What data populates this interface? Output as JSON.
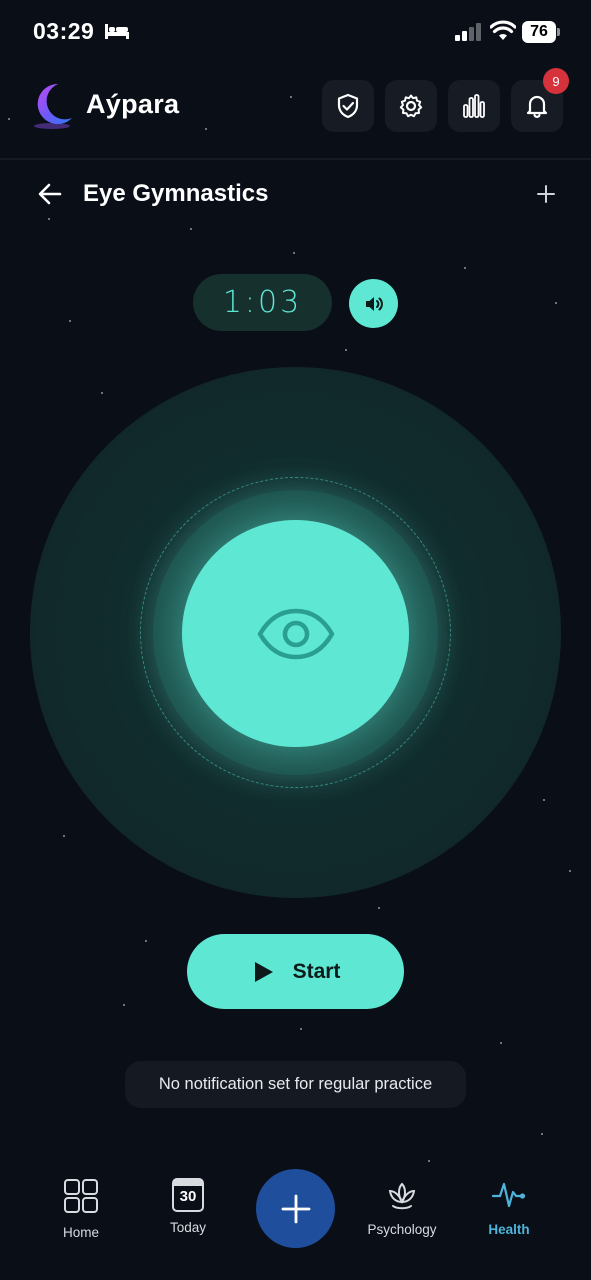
{
  "status_bar": {
    "time": "03:29",
    "battery": "76"
  },
  "app": {
    "title": "Aýpara",
    "notification_count": "9"
  },
  "page": {
    "title": "Eye Gymnastics"
  },
  "timer": {
    "display": "1:03"
  },
  "start_button": {
    "label": "Start"
  },
  "notification_note": {
    "text": "No notification set for regular practice"
  },
  "bottom_nav": {
    "items": [
      {
        "label": "Home",
        "icon": "grid-icon"
      },
      {
        "label": "Today",
        "icon": "calendar-icon",
        "day": "30"
      },
      {
        "label": "Psychology",
        "icon": "lotus-icon"
      },
      {
        "label": "Health",
        "icon": "heartbeat-icon",
        "active": true
      }
    ],
    "fab_icon": "plus-icon"
  },
  "colors": {
    "background": "#0a0e17",
    "accent": "#5ee8d4",
    "fab": "#1f4f9c",
    "active_nav": "#4fb4d9",
    "badge": "#d6323c"
  }
}
